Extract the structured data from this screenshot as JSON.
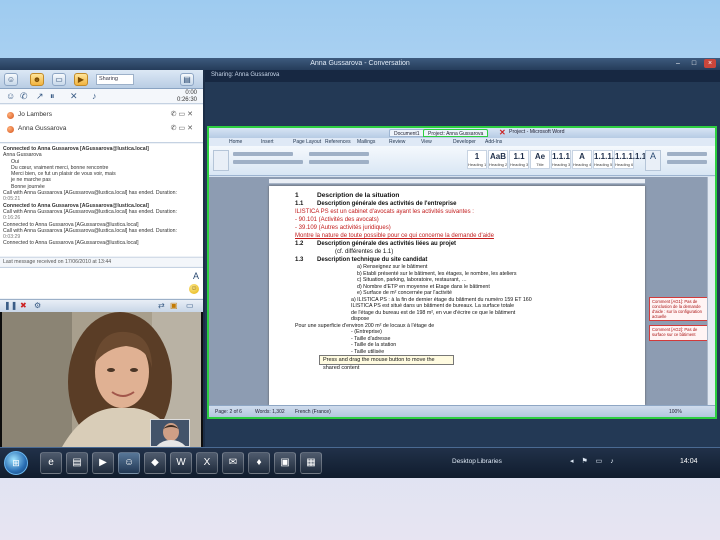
{
  "window": {
    "title": "Anna Gussarova - Conversation"
  },
  "left_toolbar": {
    "sharing_dropdown": "Sharing"
  },
  "timers": {
    "a": "0:00",
    "b": "0:26:30"
  },
  "share_header": "Sharing: Anna Gussarova",
  "participants": [
    {
      "name": "Jo Lambers"
    },
    {
      "name": "Anna Gussarova"
    }
  ],
  "chat": {
    "lines": [
      {
        "text": "Connected to Anna Gussarova [AGussarova@lustica.local]",
        "style": "bold"
      },
      {
        "text": "Anna Gussarova",
        "style": ""
      },
      {
        "text": "Oui",
        "style": "indent"
      },
      {
        "text": "Du cœur, vraiment merci, bonne rencontre",
        "style": "indent"
      },
      {
        "text": "Merci bien, ce fut un plaisir de vous voir, mais",
        "style": "indent"
      },
      {
        "text": "je ne marche pas",
        "style": "indent"
      },
      {
        "text": "Bonne journée",
        "style": "indent"
      },
      {
        "text": "Call with Anna Gussarova [AGussarova@lustica.local] has ended. Duration:",
        "style": ""
      },
      {
        "text": "0:05:21",
        "style": "time"
      },
      {
        "text": "Connected to Anna Gussarova [AGussarova@lustica.local]",
        "style": "bold"
      },
      {
        "text": "Call with Anna Gussarova [AGussarova@lustica.local] has ended. Duration:",
        "style": ""
      },
      {
        "text": "0:16:26",
        "style": "time"
      },
      {
        "text": "Connected to Anna Gussarova [AGussarova@lustica.local]",
        "style": ""
      },
      {
        "text": "Call with Anna Gussarova [AGussarova@lustica.local] has ended. Duration:",
        "style": ""
      },
      {
        "text": "0:03:29",
        "style": "time"
      },
      {
        "text": "Connected to Anna Gussarova [AGussarova@lustica.local]",
        "style": ""
      }
    ],
    "last_message": "Last message received on 17/06/2010 at 13:44"
  },
  "word": {
    "tabs": [
      "Document1",
      "Project: Anna Gussarova"
    ],
    "doc_title": "Project - Microsoft Word",
    "ribbon_tabs": [
      "Home",
      "Insert",
      "Page Layout",
      "References",
      "Mailings",
      "Review",
      "View",
      "Developer",
      "Add-Ins"
    ],
    "styles": [
      {
        "sample": "1",
        "name": "Heading 1"
      },
      {
        "sample": "AaB",
        "name": "Heading 2"
      },
      {
        "sample": "1.1",
        "name": "Heading 3"
      },
      {
        "sample": "Ae",
        "name": "Title"
      },
      {
        "sample": "1.1.1",
        "name": "Heading 3"
      },
      {
        "sample": "A",
        "name": "Heading 4"
      },
      {
        "sample": "1.1.1.1",
        "name": "Heading 5"
      },
      {
        "sample": "1.1.1.1.1",
        "name": "Heading 6"
      }
    ],
    "doc_lines": [
      {
        "num": "1",
        "text": "Description de la situation",
        "cls": "h1"
      },
      {
        "num": "1.1",
        "text": "Description générale des activités de l'entreprise",
        "cls": "h2"
      },
      {
        "num": "",
        "text": "ILISTICA PS est un cabinet d'avocats ayant les activités suivantes :",
        "cls": "red"
      },
      {
        "num": "",
        "text": "- 90.101 (Activités des avocats)",
        "cls": "red"
      },
      {
        "num": "",
        "text": "- 39.109 (Autres activités juridiques)",
        "cls": "red"
      },
      {
        "num": "",
        "text": "Montre la nature de toute possible pour ce qui concerne la demande d'aide",
        "cls": "redu"
      },
      {
        "num": "1.2",
        "text": "Description générale des activités liées au projet",
        "cls": "h2"
      },
      {
        "num": "",
        "text": "(cf. différentes de 1.1)",
        "cls": "sub"
      },
      {
        "num": "1.3",
        "text": "Description technique du site candidat",
        "cls": "h2"
      },
      {
        "num": "",
        "text": "a) Renseignez sur le bâtiment",
        "cls": "small ind2"
      },
      {
        "num": "",
        "text": "b) Établi présenté sur le bâtiment, les étages, le nombre, les ateliers",
        "cls": "small ind2"
      },
      {
        "num": "",
        "text": "c) Situation, parking, laboratoire, restaurant, …",
        "cls": "small ind2"
      },
      {
        "num": "",
        "text": "d) Nombre d'ETP en moyenne et Etage dans le bâtiment",
        "cls": "small ind2"
      },
      {
        "num": "",
        "text": "e) Surface de m² concernée par l'activité",
        "cls": "small ind2"
      },
      {
        "num": "",
        "text": "a) ILISTICA PS : à la fin de dernier étage du bâtiment du numéro 159 ET 160",
        "cls": "small ind"
      },
      {
        "num": "",
        "text": "ILISTICA PS est situé dans un bâtiment de bureaux. La surface totale",
        "cls": "small ind"
      },
      {
        "num": "",
        "text": "de l'étage du bureau est de 198 m², en vue d'écrire ce que le bâtiment",
        "cls": "small ind"
      },
      {
        "num": "",
        "text": "dispose",
        "cls": "small ind"
      },
      {
        "num": "",
        "text": "",
        "cls": "small"
      },
      {
        "num": "",
        "text": "Pour une superficie d'environ 200 m² de locaux à l'étage de",
        "cls": "small"
      },
      {
        "num": "",
        "text": "- (Entreprise)",
        "cls": "small ind"
      },
      {
        "num": "",
        "text": "- Taille d'adresse",
        "cls": "small ind"
      },
      {
        "num": "",
        "text": "- Taille de la station",
        "cls": "small ind"
      },
      {
        "num": "",
        "text": "- Taille utilisée",
        "cls": "small ind"
      }
    ],
    "tooltip": "Press and drag the mouse button to move the shared content",
    "comments": [
      "Comment [AG1]: Pas de conclusion de la demande d'aide : sur la configuration actuelle",
      "Comment [AG2]: Pas de surface sur ce bâtiment"
    ],
    "status": [
      "Page: 2 of 6",
      "Words: 1,302",
      "French (France)",
      "100%"
    ]
  },
  "taskbar": {
    "desktop_label": "Desktop",
    "libraries_label": "Libraries",
    "clock": "14:04"
  }
}
